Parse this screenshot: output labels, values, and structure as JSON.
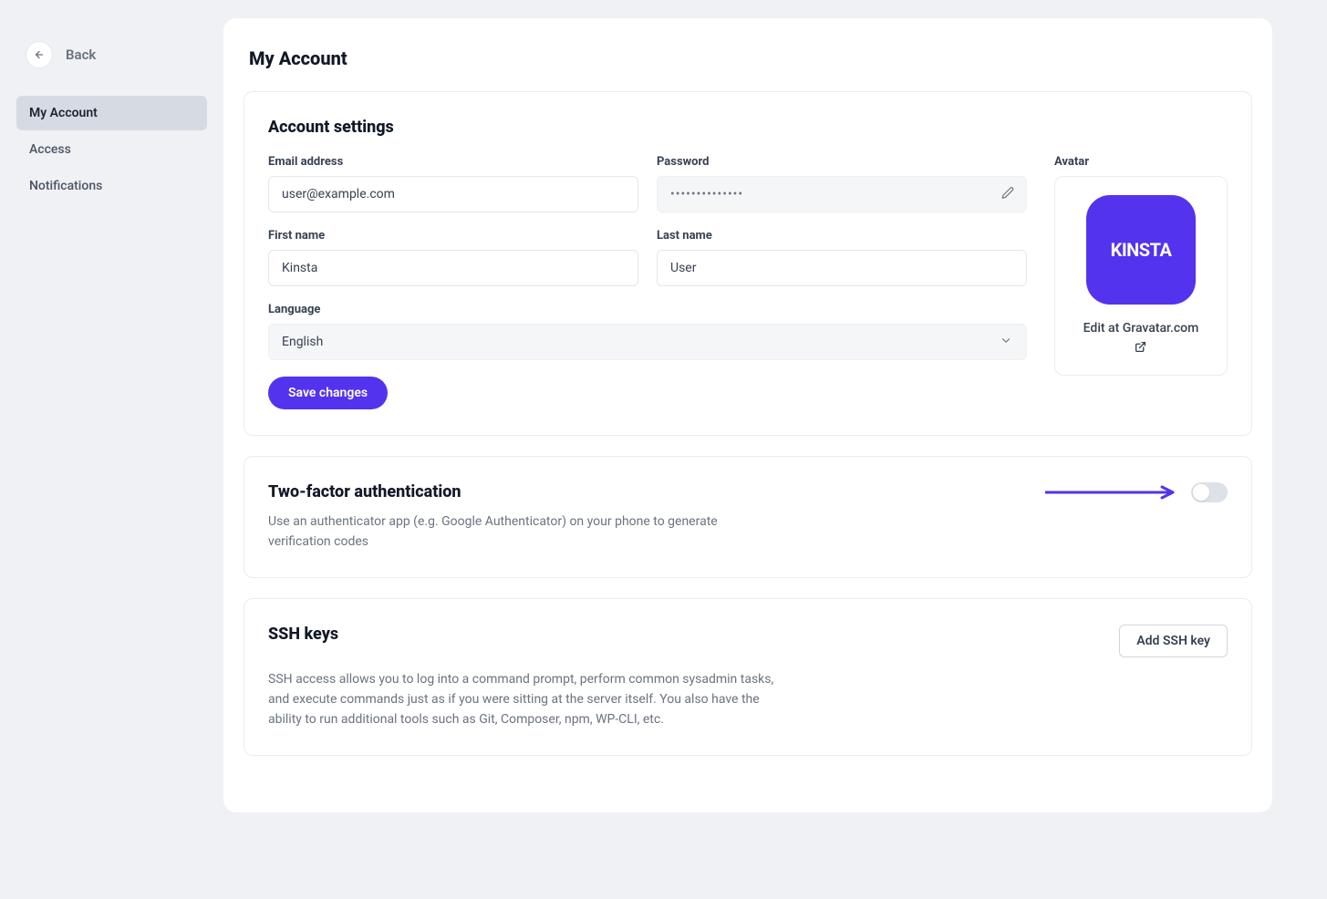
{
  "sidebar": {
    "back_label": "Back",
    "items": [
      {
        "label": "My Account",
        "active": true
      },
      {
        "label": "Access",
        "active": false
      },
      {
        "label": "Notifications",
        "active": false
      }
    ]
  },
  "page": {
    "title": "My Account"
  },
  "account_settings": {
    "title": "Account settings",
    "email_label": "Email address",
    "email_value": "user@example.com",
    "password_label": "Password",
    "password_mask": "••••••••••••••",
    "first_name_label": "First name",
    "first_name_value": "Kinsta",
    "last_name_label": "Last name",
    "last_name_value": "User",
    "language_label": "Language",
    "language_value": "English",
    "save_label": "Save changes",
    "avatar_label": "Avatar",
    "avatar_text": "KINSTA",
    "gravatar_link": "Edit at Gravatar.com"
  },
  "twofa": {
    "title": "Two-factor authentication",
    "description": "Use an authenticator app (e.g. Google Authenticator) on your phone to generate verification codes",
    "enabled": false
  },
  "ssh": {
    "title": "SSH keys",
    "add_label": "Add SSH key",
    "description": "SSH access allows you to log into a command prompt, perform common sysadmin tasks, and execute commands just as if you were sitting at the server itself. You also have the ability to run additional tools such as Git, Composer, npm, WP-CLI, etc."
  },
  "colors": {
    "primary": "#5333ed",
    "bg": "#eff1f5"
  }
}
